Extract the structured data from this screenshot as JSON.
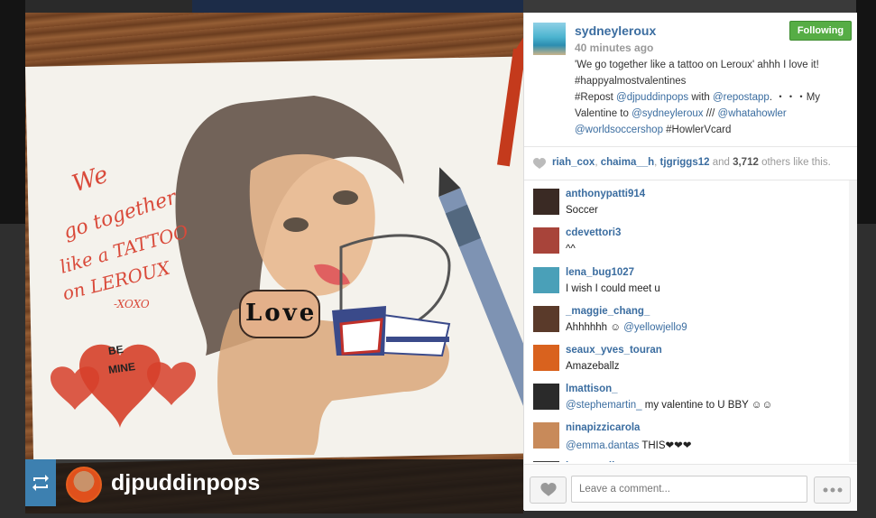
{
  "owner": {
    "username": "sydneyleroux",
    "time": "40 minutes ago",
    "follow_label": "Following"
  },
  "caption": {
    "line1": "'We go together like a tattoo on Leroux' ahhh I love it!",
    "line2": "#happyalmostvalentines",
    "line3_prefix": "#Repost ",
    "line3_link1": "@djpuddinpops",
    "line3_mid": " with ",
    "line3_link2": "@repostapp",
    "line3_suffix": ". ・・・My",
    "line4_prefix": "Valentine to ",
    "line4_link1": "@sydneyleroux",
    "line4_mid": " /// ",
    "line4_link2": "@whatahowler",
    "line5_link": "@worldsoccershop",
    "line5_suffix": " #HowlerVcard"
  },
  "likes": {
    "users": [
      "riah_cox",
      "chaima__h",
      "tjgriggs12"
    ],
    "sep": ", ",
    "and_text": " and ",
    "count": "3,712",
    "others_text": " others like this."
  },
  "comments": [
    {
      "user": "anthonypatti914",
      "text": "Soccer",
      "avatar_color": "#3a2a24"
    },
    {
      "user": "cdevettori3",
      "text": "^^",
      "avatar_color": "#a8443a"
    },
    {
      "user": "lena_bug1027",
      "text": "I wish I could meet u",
      "avatar_color": "#4aa0b8"
    },
    {
      "user": "_maggie_chang_",
      "text_prefix": "Ahhhhhh ☺ ",
      "text_link": "@yellowjello9",
      "avatar_color": "#5a3a2a"
    },
    {
      "user": "seaux_yves_touran",
      "text": "Amazeballz",
      "avatar_color": "#d9621e"
    },
    {
      "user": "lmattison_",
      "text_link": "@stephemartin_",
      "text_suffix": " my valentine to U BBY ☺☺",
      "avatar_color": "#2a2a2a"
    },
    {
      "user": "ninapizzicarola",
      "text_link": "@emma.dantas",
      "text_suffix": " THIS❤❤❤",
      "avatar_color": "#c88a5a"
    },
    {
      "user": "jennaparliament",
      "text": "",
      "avatar_color": "#3a3a3a"
    }
  ],
  "comment_input": {
    "placeholder": "Leave a comment..."
  },
  "photo": {
    "repost_user": "djpuddinpops",
    "drawing_text": {
      "line1": "We",
      "line2": "go together",
      "line3": "like a TATTOO",
      "line4": "on LEROUX",
      "xoxo": "-XOXO",
      "heart_text1": "BE",
      "heart_text2": "MINE",
      "arm_text": "Love"
    }
  },
  "colors": {
    "link": "#3b6da0",
    "follow": "#56ad45",
    "repost_badge": "#3d80b0"
  }
}
